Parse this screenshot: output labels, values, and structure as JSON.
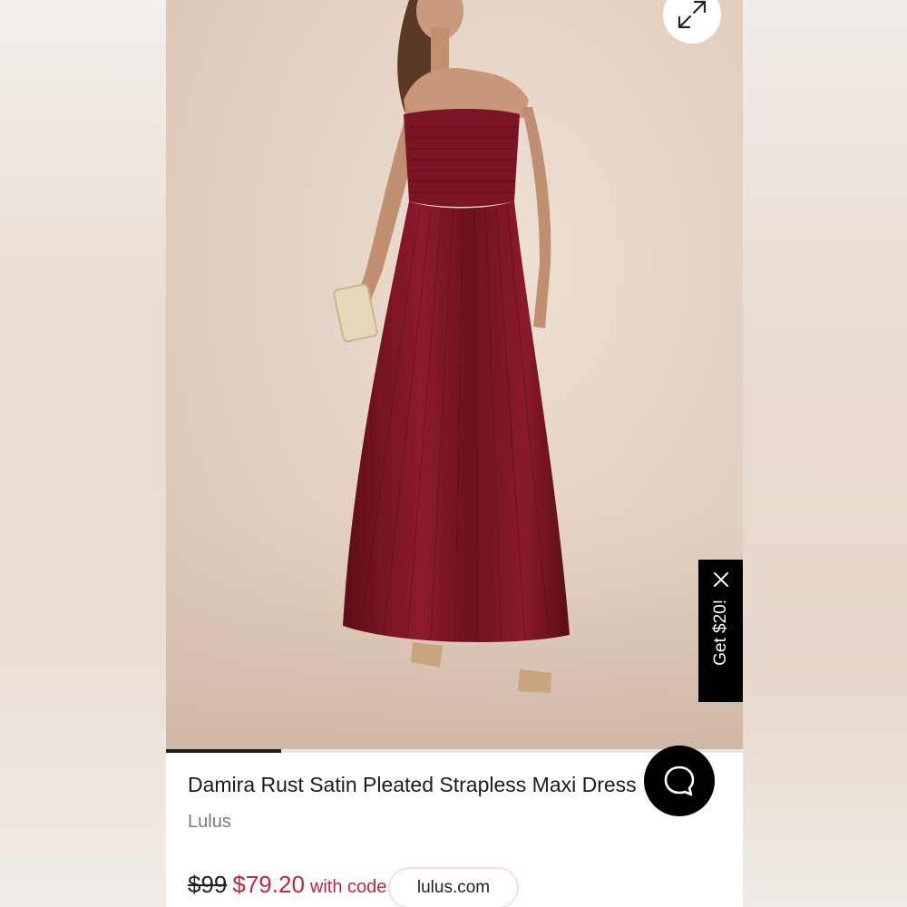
{
  "product": {
    "title": "Damira Rust Satin Pleated Strapless Maxi Dress",
    "brand": "Lulus",
    "old_price": "$99",
    "new_price": "$79.20",
    "price_note": "with code"
  },
  "promo": {
    "label": "Get $20!"
  },
  "watermark": {
    "text": "lulus.com"
  },
  "carousel": {
    "progress_fraction": 0.2
  },
  "icons": {
    "expand": "expand-arrows-icon",
    "close": "close-icon",
    "chat": "chat-bubble-icon"
  },
  "colors": {
    "sale_red": "#c6253d",
    "dress": "#7b1424",
    "backdrop": "#e3cfc0"
  }
}
